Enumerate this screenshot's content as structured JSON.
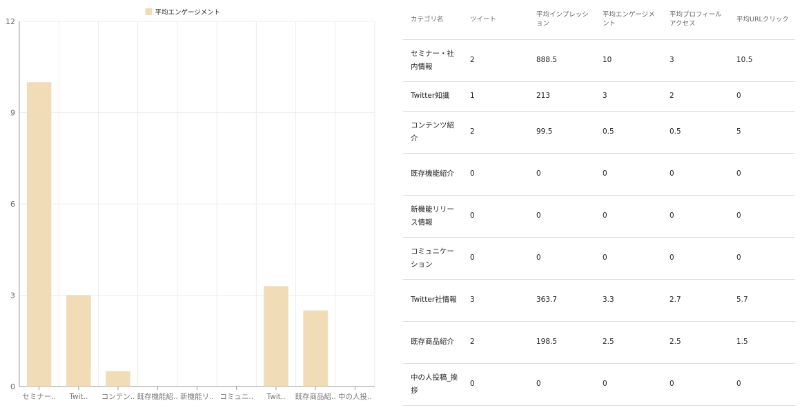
{
  "chart_data": {
    "type": "bar",
    "legend": {
      "label": "平均エンゲージメント",
      "color": "#f0dcb6",
      "placement": "top-center"
    },
    "categories": [
      "セミナー・社内情報",
      "Twitter知識",
      "コンテンツ紹介",
      "既存機能紹介",
      "新機能リリース情報",
      "コミュニケーション",
      "Twitter社情報",
      "既存商品紹介",
      "中の人投稿_挨拶"
    ],
    "category_labels": [
      "セミナー..",
      "Twit..",
      "コンテン..",
      "既存機能紹..",
      "新機能リ..",
      "コミュニ..",
      "Twit..",
      "既存商品紹..",
      "中の人投.."
    ],
    "values": [
      10,
      3,
      0.5,
      0,
      0,
      0,
      3.3,
      2.5,
      0
    ],
    "ylim": [
      0,
      12
    ],
    "yticks": [
      "0",
      "3",
      "6",
      "9",
      "12"
    ],
    "grid": true,
    "bar_color": "#f0dcb6"
  },
  "table": {
    "headers": [
      "カテゴリ名",
      "ツイート",
      "平均インプレッション",
      "平均エンゲージメント",
      "平均プロフィールアクセス",
      "平均URLクリック"
    ],
    "rows": [
      [
        "セミナー・社内情報",
        "2",
        "888.5",
        "10",
        "3",
        "10.5"
      ],
      [
        "Twitter知識",
        "1",
        "213",
        "3",
        "2",
        "0"
      ],
      [
        "コンテンツ紹介",
        "2",
        "99.5",
        "0.5",
        "0.5",
        "5"
      ],
      [
        "既存機能紹介",
        "0",
        "0",
        "0",
        "0",
        "0"
      ],
      [
        "新機能リリース情報",
        "0",
        "0",
        "0",
        "0",
        "0"
      ],
      [
        "コミュニケーション",
        "0",
        "0",
        "0",
        "0",
        "0"
      ],
      [
        "Twitter社情報",
        "3",
        "363.7",
        "3.3",
        "2.7",
        "5.7"
      ],
      [
        "既存商品紹介",
        "2",
        "198.5",
        "2.5",
        "2.5",
        "1.5"
      ],
      [
        "中の人投稿_挨拶",
        "0",
        "0",
        "0",
        "0",
        "0"
      ]
    ]
  }
}
